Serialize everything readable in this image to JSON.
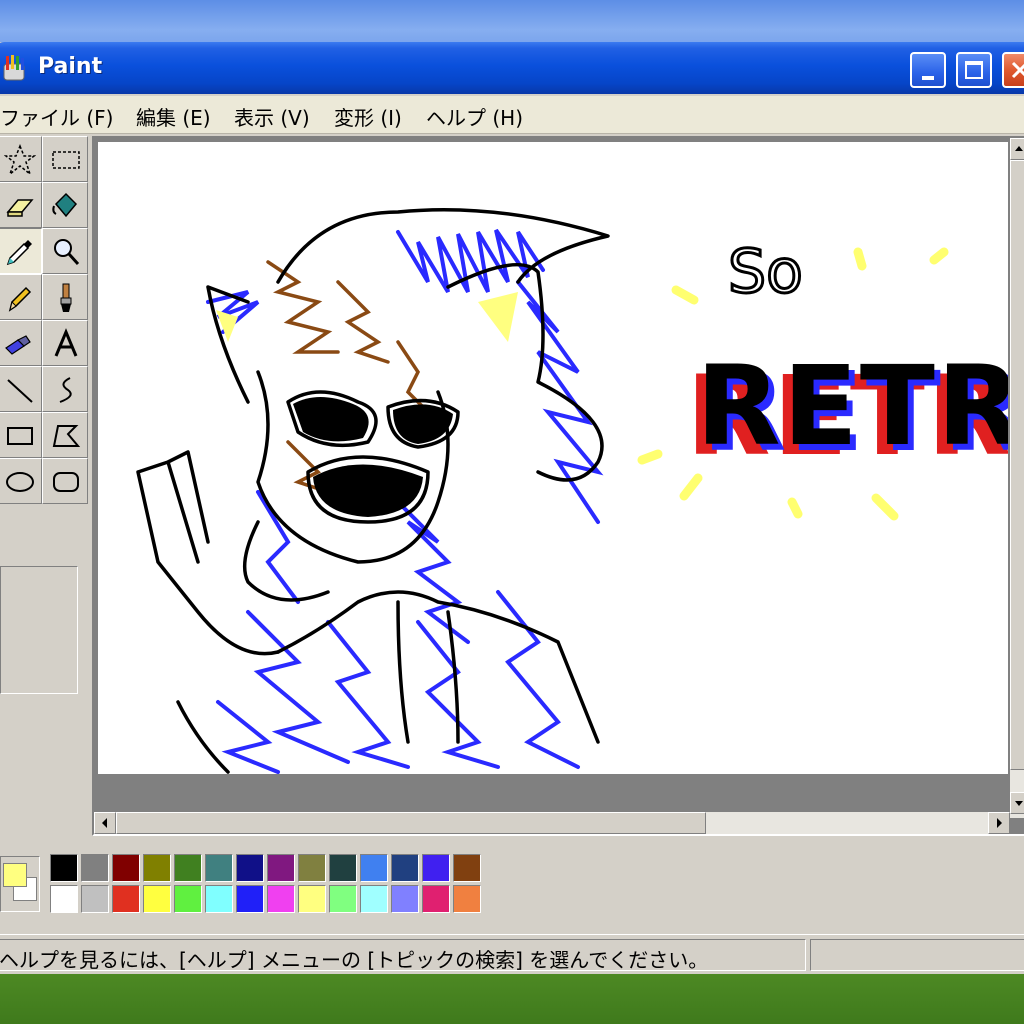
{
  "window": {
    "title": "Paint"
  },
  "menu": {
    "items": [
      {
        "label": "ファイル (F)"
      },
      {
        "label": "編集 (E)"
      },
      {
        "label": "表示 (V)"
      },
      {
        "label": "変形 (I)"
      },
      {
        "label": "ヘルプ (H)"
      }
    ]
  },
  "tools": [
    "free-form-select",
    "select",
    "eraser",
    "fill",
    "pick-color",
    "magnifier",
    "pencil",
    "brush",
    "airbrush",
    "text",
    "line",
    "curve",
    "rectangle",
    "polygon",
    "ellipse",
    "rounded-rectangle"
  ],
  "active_tool": "pick-color",
  "canvas": {
    "drawing_text_1": "So",
    "drawing_text_2": "RETRO!"
  },
  "colors": {
    "foreground": "#ffff80",
    "background": "#ffffff",
    "palette_row_1": [
      "#000000",
      "#808080",
      "#800000",
      "#808000",
      "#408020",
      "#408080",
      "#101088",
      "#801880",
      "#808040",
      "#204040",
      "#4080f0",
      "#204080",
      "#4020f0",
      "#804010"
    ],
    "palette_row_2": [
      "#ffffff",
      "#c0c0c0",
      "#e03020",
      "#ffff40",
      "#60f040",
      "#80ffff",
      "#2020f8",
      "#f040f0",
      "#ffff80",
      "#80ff80",
      "#a0ffff",
      "#8080ff",
      "#e02070",
      "#f08040"
    ]
  },
  "status": {
    "help_text": "ヘルプを見るには、[ヘルプ] メニューの [トピックの検索] を選んでください。"
  }
}
